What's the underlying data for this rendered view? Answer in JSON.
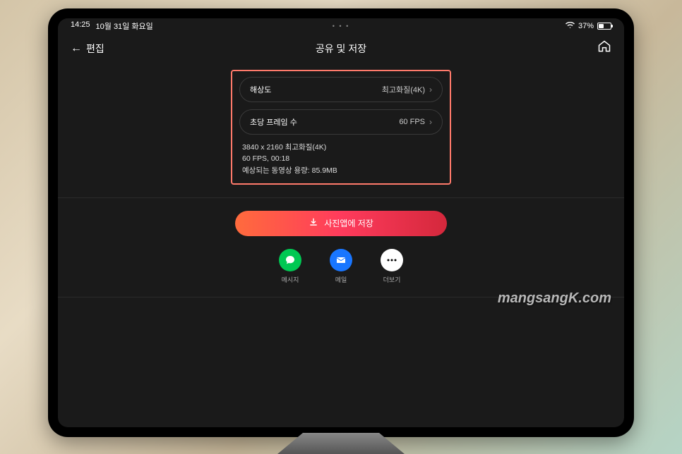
{
  "status": {
    "time": "14:25",
    "date": "10월 31일 화요일",
    "dots": "• • •",
    "battery_pct": "37%"
  },
  "nav": {
    "back_label": "편집",
    "title": "공유 및 저장"
  },
  "settings": {
    "resolution": {
      "label": "해상도",
      "value": "최고화질(4K)"
    },
    "fps": {
      "label": "초당 프레임 수",
      "value": "60 FPS"
    },
    "info_line1": "3840 x 2160 최고화질(4K)",
    "info_line2": "60 FPS, 00:18",
    "info_line3": "예상되는 동영상 용량: 85.9MB"
  },
  "save": {
    "button_label": "사진앱에 저장"
  },
  "share": {
    "messages": "메시지",
    "mail": "메일",
    "more": "더보기"
  },
  "watermark": "mangsangK.com"
}
